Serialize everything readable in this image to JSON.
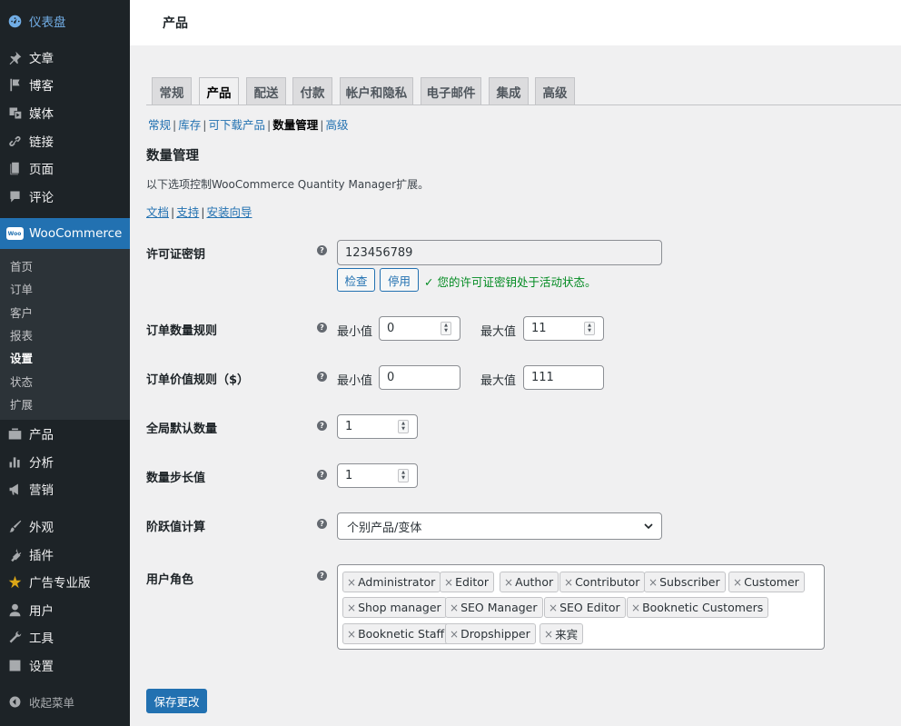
{
  "sidebar": {
    "items": [
      {
        "label": "仪表盘",
        "icon": "dashboard-icon"
      },
      {
        "label": "文章",
        "icon": "pin-icon"
      },
      {
        "label": "博客",
        "icon": "flag-icon"
      },
      {
        "label": "媒体",
        "icon": "media-icon"
      },
      {
        "label": "链接",
        "icon": "link-icon"
      },
      {
        "label": "页面",
        "icon": "page-icon"
      },
      {
        "label": "评论",
        "icon": "comment-icon"
      },
      {
        "label": "WooCommerce",
        "icon": "woo-icon"
      },
      {
        "label": "产品",
        "icon": "product-icon"
      },
      {
        "label": "分析",
        "icon": "chart-icon"
      },
      {
        "label": "营销",
        "icon": "megaphone-icon"
      },
      {
        "label": "外观",
        "icon": "brush-icon"
      },
      {
        "label": "插件",
        "icon": "plugin-icon"
      },
      {
        "label": "广告专业版",
        "icon": "star-icon"
      },
      {
        "label": "用户",
        "icon": "user-icon"
      },
      {
        "label": "工具",
        "icon": "wrench-icon"
      },
      {
        "label": "设置",
        "icon": "settings-icon"
      }
    ],
    "woo_badge": "Woo",
    "submenu": [
      "首页",
      "订单",
      "客户",
      "报表",
      "设置",
      "状态",
      "扩展"
    ],
    "collapse": "收起菜单"
  },
  "header": {
    "title": "产品"
  },
  "tabs": [
    "常规",
    "产品",
    "配送",
    "付款",
    "帐户和隐私",
    "电子邮件",
    "集成",
    "高级"
  ],
  "subnav": [
    "常规",
    "库存",
    "可下载产品",
    "数量管理",
    "高级"
  ],
  "section": {
    "title": "数量管理",
    "description": "以下选项控制WooCommerce Quantity Manager扩展。",
    "links": [
      "文档",
      "支持",
      "安装向导"
    ]
  },
  "license": {
    "label": "许可证密钥",
    "value": "123456789",
    "check_button": "检查",
    "deactivate_button": "停用",
    "status": "✓ 您的许可证密钥处于活动状态。"
  },
  "order_qty": {
    "label": "订单数量规则",
    "min_label": "最小值",
    "min": "0",
    "max_label": "最大值",
    "max": "11"
  },
  "order_value": {
    "label": "订单价值规则（$）",
    "min_label": "最小值",
    "min": "0",
    "max_label": "最大值",
    "max": "111"
  },
  "default_qty": {
    "label": "全局默认数量",
    "value": "1"
  },
  "step": {
    "label": "数量步长值",
    "value": "1"
  },
  "tier": {
    "label": "阶跃值计算",
    "selected": "个别产品/变体"
  },
  "roles": {
    "label": "用户角色",
    "tags": [
      "Administrator",
      "Editor",
      "Author",
      "Contributor",
      "Subscriber",
      "Customer",
      "Shop manager",
      "SEO Manager",
      "SEO Editor",
      "Booknetic Customers",
      "Booknetic Staff",
      "Dropshipper",
      "来宾"
    ]
  },
  "save_button": "保存更改",
  "colors": {
    "accent": "#2271b1",
    "sidebar": "#1d2327",
    "success": "#008a20"
  }
}
